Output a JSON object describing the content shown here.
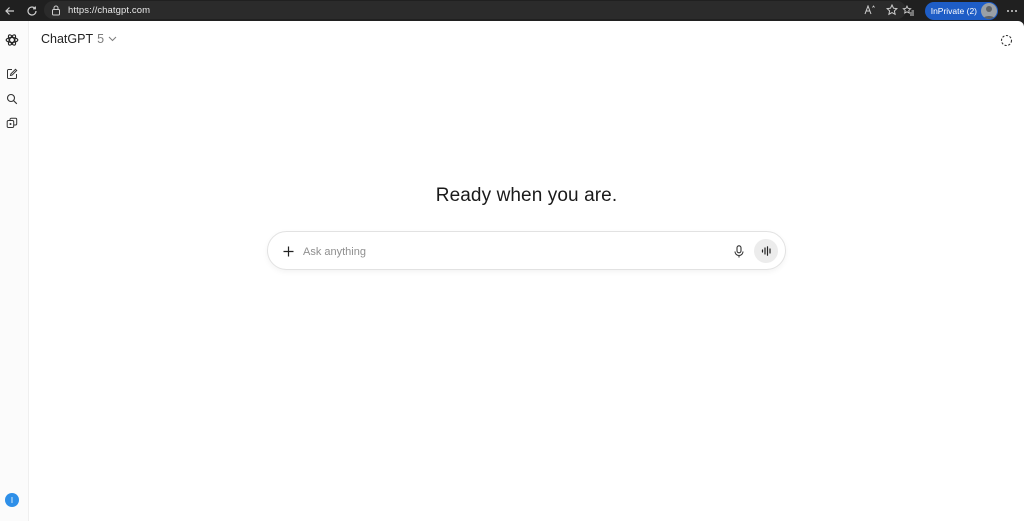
{
  "browser": {
    "url": "https://chatgpt.com",
    "inprivate_label": "InPrivate (2)",
    "icons": [
      "back-icon",
      "refresh-icon",
      "lock-icon",
      "read-aloud-icon",
      "favorite-star-icon",
      "favorites-icon",
      "more-icon"
    ]
  },
  "sidebar": {
    "user_initial": "I",
    "icons": [
      "openai-logo-icon",
      "new-chat-icon",
      "search-icon",
      "library-icon"
    ]
  },
  "header": {
    "model_name": "ChatGPT",
    "model_version": "5"
  },
  "main": {
    "heading": "Ready when you are."
  },
  "composer": {
    "placeholder": "Ask anything",
    "value": ""
  },
  "colors": {
    "chrome_bg": "#202020",
    "inprivate_badge": "#1e5dc6",
    "avatar": "#2e8fe8",
    "page_bg": "#ffffff"
  }
}
